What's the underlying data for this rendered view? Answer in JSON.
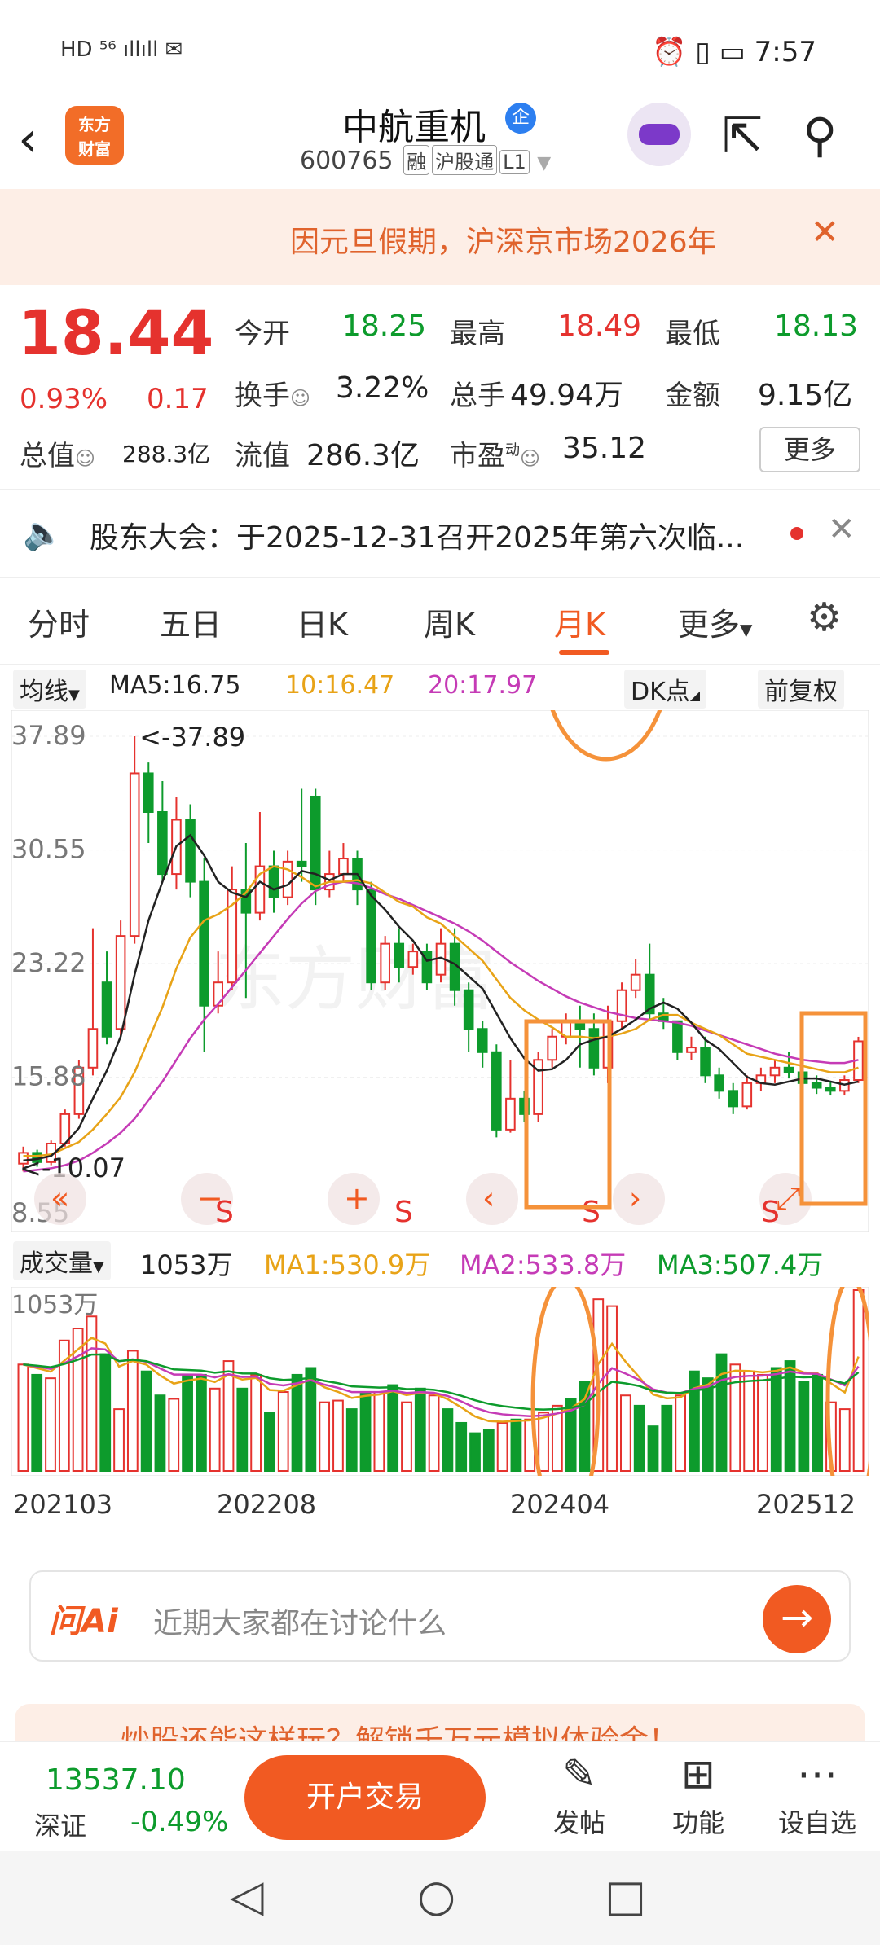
{
  "status_bar": {
    "left": "HD 5G ∥ ",
    "time": "7:57"
  },
  "header": {
    "back_icon": "back-arrow",
    "logo_text": "东方财富",
    "stock_name": "中航重机",
    "badge": "企",
    "code": "600765",
    "tags": [
      "融",
      "沪股通",
      "L1"
    ]
  },
  "notice": {
    "text": "因元旦假期，沪深京市场2026年",
    "close": "✕"
  },
  "quote": {
    "price": "18.44",
    "change_pct": "0.93%",
    "change_val": "0.17",
    "open_label": "今开",
    "open": "18.25",
    "high_label": "最高",
    "high": "18.49",
    "low_label": "最低",
    "low": "18.13",
    "turnover_label": "换手",
    "turnover": "3.22%",
    "volume_label": "总手",
    "volume": "49.94万",
    "amount_label": "金额",
    "amount": "9.15亿",
    "mktcap_label": "总值",
    "mktcap": "288.3亿",
    "float_label": "流值",
    "float": "286.3亿",
    "pe_label": "市盈",
    "pe_sup": "动",
    "pe": "35.12",
    "more": "更多"
  },
  "announcement": {
    "text": "股东大会：于2025-12-31召开2025年第六次临..."
  },
  "tabs": {
    "items": [
      "分时",
      "五日",
      "日K",
      "周K",
      "月K",
      "更多"
    ],
    "active": "月K"
  },
  "ma_bar": {
    "type": "均线",
    "ma5": "MA5:16.75",
    "ma10": "10:16.47",
    "ma20": "20:17.97",
    "dk": "DK点",
    "adjust": "前复权"
  },
  "colors": {
    "ma5": "#222222",
    "ma10": "#e8a317",
    "ma20": "#c53bb6",
    "up": "#e5322e",
    "down": "#0d9b2c",
    "accent": "#f15a22"
  },
  "chart_data": {
    "type": "candlestick",
    "y_ticks": [
      "37.89",
      "30.55",
      "23.22",
      "15.88"
    ],
    "y_min_label": "8.55",
    "max_marker": "<-37.89",
    "min_marker": "<-10.07",
    "ylim": [
      8.55,
      37.89
    ],
    "x_labels": [
      "202103",
      "202208",
      "202404",
      "202512"
    ],
    "candles": [
      {
        "o": 10.3,
        "c": 11.0,
        "h": 11.4,
        "l": 9.8
      },
      {
        "o": 11.0,
        "c": 10.4,
        "h": 11.2,
        "l": 10.1
      },
      {
        "o": 10.4,
        "c": 11.6,
        "h": 11.8,
        "l": 10.2
      },
      {
        "o": 11.6,
        "c": 13.5,
        "h": 13.8,
        "l": 11.4
      },
      {
        "o": 13.5,
        "c": 16.5,
        "h": 17.0,
        "l": 13.2
      },
      {
        "o": 16.5,
        "c": 19.0,
        "h": 25.5,
        "l": 16.0
      },
      {
        "o": 22.0,
        "c": 18.5,
        "h": 24.0,
        "l": 18.0
      },
      {
        "o": 19.0,
        "c": 25.0,
        "h": 26.0,
        "l": 18.5
      },
      {
        "o": 25.0,
        "c": 35.5,
        "h": 37.89,
        "l": 24.5
      },
      {
        "o": 35.5,
        "c": 33.0,
        "h": 36.2,
        "l": 31.0
      },
      {
        "o": 33.0,
        "c": 29.0,
        "h": 35.0,
        "l": 28.5
      },
      {
        "o": 29.0,
        "c": 32.5,
        "h": 34.0,
        "l": 28.0
      },
      {
        "o": 32.5,
        "c": 28.5,
        "h": 33.5,
        "l": 27.5
      },
      {
        "o": 28.5,
        "c": 20.5,
        "h": 30.0,
        "l": 17.5
      },
      {
        "o": 20.5,
        "c": 22.0,
        "h": 24.0,
        "l": 20.0
      },
      {
        "o": 22.0,
        "c": 28.0,
        "h": 29.5,
        "l": 21.5
      },
      {
        "o": 28.0,
        "c": 26.5,
        "h": 31.0,
        "l": 21.0
      },
      {
        "o": 26.5,
        "c": 29.5,
        "h": 33.0,
        "l": 26.0
      },
      {
        "o": 29.5,
        "c": 27.5,
        "h": 30.5,
        "l": 26.5
      },
      {
        "o": 27.5,
        "c": 29.8,
        "h": 30.5,
        "l": 27.0
      },
      {
        "o": 29.8,
        "c": 29.5,
        "h": 34.5,
        "l": 28.5
      },
      {
        "o": 34.0,
        "c": 28.0,
        "h": 34.5,
        "l": 27.0
      },
      {
        "o": 28.0,
        "c": 29.0,
        "h": 30.5,
        "l": 27.5
      },
      {
        "o": 29.0,
        "c": 30.0,
        "h": 31.0,
        "l": 28.5
      },
      {
        "o": 30.0,
        "c": 28.0,
        "h": 30.5,
        "l": 27.0
      },
      {
        "o": 28.0,
        "c": 22.0,
        "h": 28.5,
        "l": 21.5
      },
      {
        "o": 22.0,
        "c": 24.5,
        "h": 25.0,
        "l": 21.5
      },
      {
        "o": 24.5,
        "c": 23.0,
        "h": 25.5,
        "l": 22.0
      },
      {
        "o": 23.0,
        "c": 24.0,
        "h": 24.5,
        "l": 22.5
      },
      {
        "o": 24.0,
        "c": 22.0,
        "h": 24.5,
        "l": 21.5
      },
      {
        "o": 22.5,
        "c": 24.5,
        "h": 25.5,
        "l": 22.0
      },
      {
        "o": 24.5,
        "c": 21.5,
        "h": 25.5,
        "l": 20.5
      },
      {
        "o": 21.5,
        "c": 19.0,
        "h": 22.0,
        "l": 17.5
      },
      {
        "o": 19.0,
        "c": 17.5,
        "h": 19.5,
        "l": 16.5
      },
      {
        "o": 17.5,
        "c": 12.5,
        "h": 18.0,
        "l": 12.0
      },
      {
        "o": 12.5,
        "c": 14.5,
        "h": 17.0,
        "l": 12.3
      },
      {
        "o": 14.5,
        "c": 13.5,
        "h": 15.0,
        "l": 13.0
      },
      {
        "o": 13.5,
        "c": 17.0,
        "h": 17.5,
        "l": 13.0
      },
      {
        "o": 17.0,
        "c": 18.5,
        "h": 19.0,
        "l": 16.5
      },
      {
        "o": 18.5,
        "c": 19.5,
        "h": 20.0,
        "l": 18.0
      },
      {
        "o": 19.5,
        "c": 19.0,
        "h": 20.5,
        "l": 16.5
      },
      {
        "o": 19.0,
        "c": 16.5,
        "h": 20.0,
        "l": 16.0
      },
      {
        "o": 16.5,
        "c": 19.5,
        "h": 20.5,
        "l": 15.5
      },
      {
        "o": 19.5,
        "c": 21.5,
        "h": 22.0,
        "l": 19.0
      },
      {
        "o": 21.5,
        "c": 22.5,
        "h": 23.5,
        "l": 21.0
      },
      {
        "o": 22.5,
        "c": 20.0,
        "h": 24.5,
        "l": 19.5
      },
      {
        "o": 20.0,
        "c": 19.5,
        "h": 21.0,
        "l": 19.0
      },
      {
        "o": 19.5,
        "c": 17.5,
        "h": 19.5,
        "l": 17.0
      },
      {
        "o": 17.5,
        "c": 17.8,
        "h": 18.5,
        "l": 17.0
      },
      {
        "o": 17.8,
        "c": 16.0,
        "h": 18.5,
        "l": 15.5
      },
      {
        "o": 16.0,
        "c": 15.0,
        "h": 16.5,
        "l": 14.5
      },
      {
        "o": 15.0,
        "c": 14.0,
        "h": 15.5,
        "l": 13.5
      },
      {
        "o": 14.0,
        "c": 15.5,
        "h": 16.0,
        "l": 13.8
      },
      {
        "o": 15.5,
        "c": 16.0,
        "h": 16.5,
        "l": 15.0
      },
      {
        "o": 16.0,
        "c": 16.5,
        "h": 17.0,
        "l": 15.5
      },
      {
        "o": 16.5,
        "c": 16.2,
        "h": 17.5,
        "l": 15.8
      },
      {
        "o": 16.2,
        "c": 15.5,
        "h": 16.5,
        "l": 15.0
      },
      {
        "o": 15.5,
        "c": 15.2,
        "h": 16.0,
        "l": 14.8
      },
      {
        "o": 15.2,
        "c": 15.0,
        "h": 15.6,
        "l": 14.7
      },
      {
        "o": 15.0,
        "c": 15.7,
        "h": 16.0,
        "l": 14.7
      },
      {
        "o": 15.7,
        "c": 18.2,
        "h": 18.49,
        "l": 15.5
      }
    ],
    "ma5_line": [
      10.5,
      10.6,
      10.8,
      11.6,
      12.6,
      14.5,
      16.3,
      18.5,
      22.5,
      26.0,
      28.5,
      30.8,
      31.5,
      30.2,
      28.5,
      27.8,
      27.5,
      28.5,
      28.0,
      28.3,
      29.2,
      29.0,
      28.6,
      29.0,
      29.0,
      27.6,
      26.7,
      25.6,
      24.7,
      23.4,
      23.6,
      23.2,
      22.4,
      21.6,
      20.0,
      18.4,
      17.1,
      16.3,
      16.4,
      17.0,
      18.0,
      18.3,
      18.5,
      19.0,
      19.6,
      20.3,
      20.7,
      20.3,
      19.4,
      18.3,
      17.7,
      16.8,
      15.9,
      15.5,
      15.4,
      15.6,
      15.8,
      15.8,
      15.6,
      15.4,
      15.6
    ],
    "ma10_line": [
      10.8,
      10.8,
      10.9,
      11.3,
      11.7,
      12.5,
      13.5,
      14.6,
      16.2,
      18.3,
      20.4,
      22.9,
      24.9,
      26.0,
      26.4,
      27.0,
      27.8,
      29.0,
      29.5,
      29.3,
      28.8,
      28.2,
      28.5,
      28.5,
      28.6,
      28.4,
      27.8,
      27.2,
      26.9,
      26.2,
      25.8,
      25.0,
      24.2,
      23.4,
      22.2,
      21.0,
      20.2,
      19.6,
      19.1,
      18.5,
      18.5,
      18.4,
      18.5,
      18.7,
      19.0,
      19.6,
      19.9,
      19.9,
      19.4,
      19.0,
      18.6,
      18.0,
      17.4,
      17.2,
      17.0,
      16.8,
      16.6,
      16.4,
      16.2,
      16.2,
      16.5
    ],
    "ma20_line": [
      9.8,
      9.9,
      10.0,
      10.2,
      10.5,
      11.0,
      11.6,
      12.3,
      13.2,
      14.4,
      15.6,
      17.0,
      18.4,
      19.6,
      20.6,
      21.7,
      22.8,
      23.9,
      25.0,
      26.1,
      27.1,
      27.9,
      28.3,
      28.5,
      28.4,
      28.1,
      27.7,
      27.4,
      27.0,
      26.6,
      26.2,
      25.8,
      25.3,
      24.7,
      24.0,
      23.3,
      22.7,
      22.1,
      21.6,
      21.1,
      20.7,
      20.4,
      20.1,
      19.9,
      19.7,
      19.6,
      19.5,
      19.4,
      19.2,
      18.9,
      18.6,
      18.3,
      18.0,
      17.7,
      17.4,
      17.2,
      17.0,
      16.9,
      16.8,
      16.8,
      17.0
    ],
    "volume_header": {
      "label": "成交量",
      "value": "1053万",
      "ma1": "MA1:530.9万",
      "ma2": "MA2:533.8万",
      "ma3": "MA3:507.4万"
    },
    "volume_max_label": "1053万",
    "volumes": [
      620,
      560,
      540,
      760,
      830,
      900,
      680,
      360,
      700,
      580,
      440,
      420,
      560,
      560,
      480,
      640,
      480,
      560,
      340,
      460,
      560,
      600,
      400,
      410,
      360,
      460,
      460,
      500,
      400,
      480,
      440,
      360,
      280,
      220,
      240,
      280,
      300,
      300,
      340,
      380,
      420,
      520,
      1000,
      960,
      440,
      380,
      260,
      380,
      440,
      580,
      540,
      680,
      620,
      580,
      560,
      600,
      640,
      520,
      560,
      400,
      360,
      1053
    ],
    "chart_nav": [
      "«",
      "−",
      "+",
      "‹",
      "›",
      "⤢"
    ],
    "signal": "S",
    "annotations": "orange-highlight-circles"
  },
  "ai": {
    "logo": "问Ai",
    "placeholder": "近期大家都在讨论什么"
  },
  "promo": {
    "text": "炒股还能这样玩？解锁千万元模拟体验金！"
  },
  "bottom": {
    "index_value": "13537.10",
    "index_name": "深证",
    "index_change": "-0.49%",
    "trade_button": "开户交易",
    "items": [
      {
        "icon": "edit-icon",
        "label": "发帖"
      },
      {
        "icon": "grid-icon",
        "label": "功能"
      },
      {
        "icon": "more-icon",
        "label": "设自选"
      }
    ]
  }
}
